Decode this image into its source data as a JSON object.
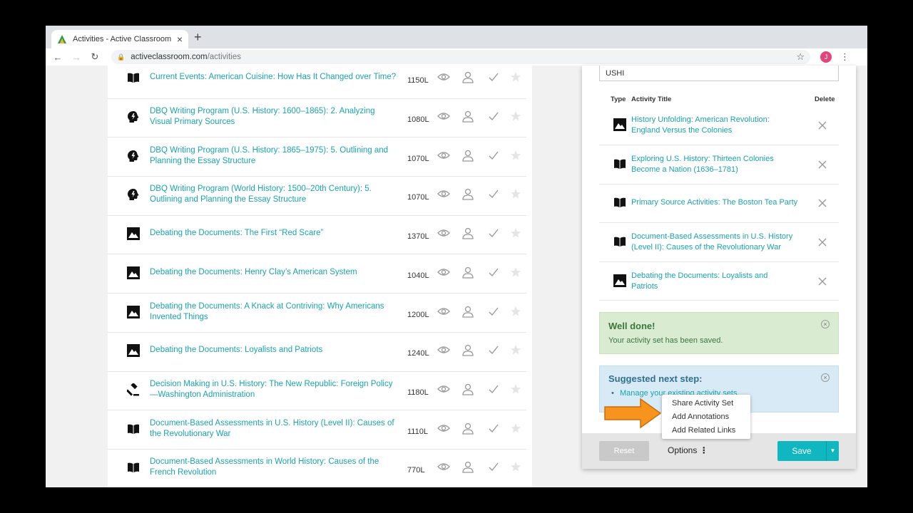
{
  "browser": {
    "tab_title": "Activities - Active Classroom",
    "url_domain": "activeclassroom.com",
    "url_path": "/activities",
    "avatar_letter": "J"
  },
  "activity_list": [
    {
      "icon": "book",
      "title_lines": [
        "Current Events: American Cuisine: How Has It Changed over Time?"
      ],
      "lexile": "1150L"
    },
    {
      "icon": "head",
      "title_lines": [
        "DBQ Writing Program (U.S. History: 1600–1865): 2. Analyzing",
        "Visual Primary Sources"
      ],
      "lexile": "1080L"
    },
    {
      "icon": "head",
      "title_lines": [
        "DBQ Writing Program (U.S. History: 1865–1975): 5. Outlining and",
        "Planning the Essay Structure"
      ],
      "lexile": "1070L"
    },
    {
      "icon": "head",
      "title_lines": [
        "DBQ Writing Program (World History: 1500–20th Century): 5.",
        "Outlining and Planning the Essay Structure"
      ],
      "lexile": "1070L"
    },
    {
      "icon": "image",
      "title_lines": [
        "Debating the Documents: The First “Red Scare”"
      ],
      "lexile": "1370L"
    },
    {
      "icon": "image",
      "title_lines": [
        "Debating the Documents: Henry Clay’s American System"
      ],
      "lexile": "1040L"
    },
    {
      "icon": "image",
      "title_lines": [
        "Debating the Documents: A Knack at Contriving: Why Americans",
        "Invented Things"
      ],
      "lexile": "1200L"
    },
    {
      "icon": "image",
      "title_lines": [
        "Debating the Documents: Loyalists and Patriots"
      ],
      "lexile": "1240L"
    },
    {
      "icon": "gavel",
      "title_lines": [
        "Decision Making in U.S. History: The New Republic: Foreign Policy",
        "—Washington Administration"
      ],
      "lexile": "1180L"
    },
    {
      "icon": "book",
      "title_lines": [
        "Document-Based Assessments in U.S. History (Level II): Causes of",
        "the Revolutionary War"
      ],
      "lexile": "1110L"
    },
    {
      "icon": "book",
      "title_lines": [
        "Document-Based Assessments in World History: Causes of the",
        "French Revolution"
      ],
      "lexile": "770L"
    }
  ],
  "set_panel": {
    "set_name_value": "USHI",
    "headers": {
      "type": "Type",
      "title": "Activity Title",
      "delete": "Delete"
    },
    "items": [
      {
        "icon": "image",
        "title_lines": [
          "History Unfolding: American Revolution:",
          "England Versus the Colonies"
        ]
      },
      {
        "icon": "book",
        "title_lines": [
          "Exploring U.S. History: Thirteen Colonies",
          "Become a Nation (1636–1781)"
        ]
      },
      {
        "icon": "book",
        "title_lines": [
          "Primary Source Activities: The Boston Tea Party"
        ]
      },
      {
        "icon": "book",
        "title_lines": [
          "Document-Based Assessments in U.S. History",
          "(Level II): Causes of the Revolutionary War"
        ]
      },
      {
        "icon": "image",
        "title_lines": [
          "Debating the Documents: Loyalists and",
          "Patriots"
        ]
      }
    ],
    "success_title": "Well done!",
    "success_message": "Your activity set has been saved.",
    "suggest_title": "Suggested next step:",
    "suggest_link": "Manage your existing activity sets",
    "reset_label": "Reset",
    "options_label": "Options",
    "save_label": "Save"
  },
  "options_menu": [
    "Share Activity Set",
    "Add Annotations",
    "Add Related Links"
  ],
  "colors": {
    "accent": "#10b6c0",
    "link": "#1aa3ad",
    "arrow": "#f7941d"
  }
}
